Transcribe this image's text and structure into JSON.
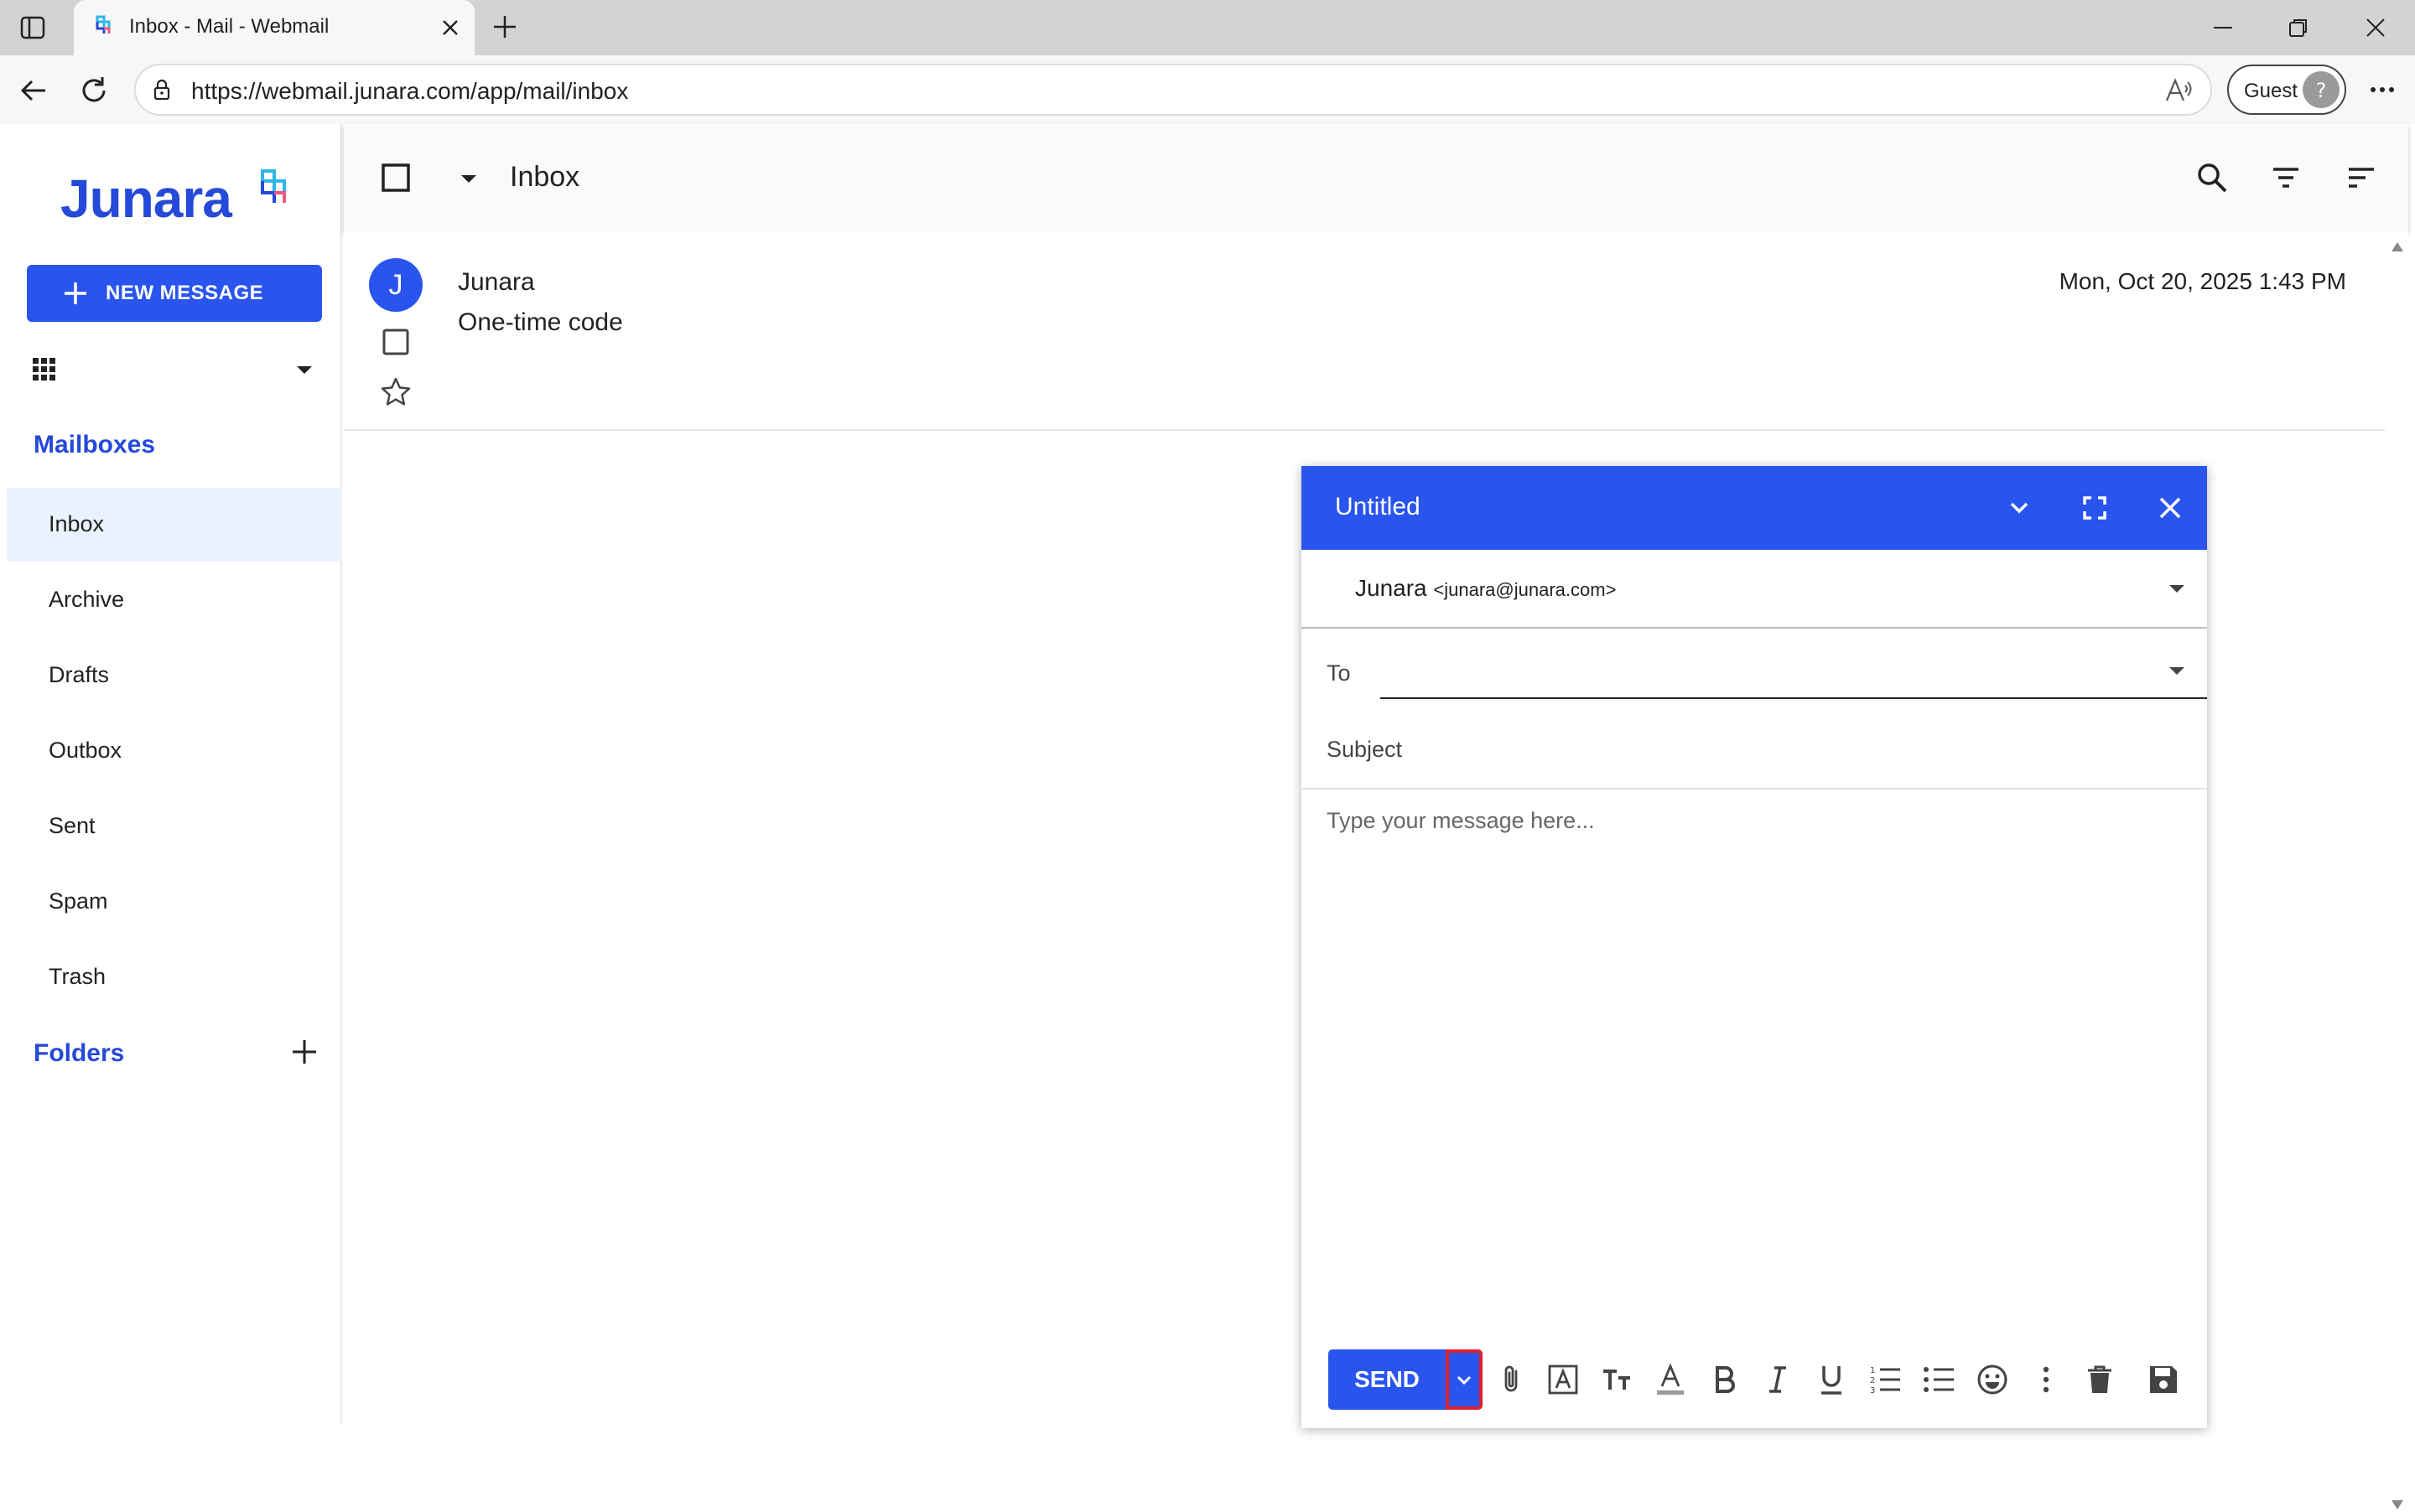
{
  "browser": {
    "tab_title": "Inbox - Mail - Webmail",
    "url": "https://webmail.junara.com/app/mail/inbox",
    "profile_label": "Guest"
  },
  "sidebar": {
    "logo_text": "Junara",
    "new_message_label": "NEW MESSAGE",
    "mailboxes_heading": "Mailboxes",
    "items": [
      {
        "label": "Inbox",
        "active": true
      },
      {
        "label": "Archive"
      },
      {
        "label": "Drafts"
      },
      {
        "label": "Outbox"
      },
      {
        "label": "Sent"
      },
      {
        "label": "Spam"
      },
      {
        "label": "Trash"
      }
    ],
    "folders_heading": "Folders"
  },
  "toolbar": {
    "mailbox_title": "Inbox"
  },
  "messages": [
    {
      "avatar_letter": "J",
      "from": "Junara",
      "subject": "One-time code",
      "date": "Mon, Oct 20, 2025 1:43 PM"
    }
  ],
  "compose": {
    "title": "Untitled",
    "from_name": "Junara",
    "from_email": "<junara@junara.com>",
    "to_label": "To",
    "to_value": "",
    "subject_placeholder": "Subject",
    "body_placeholder": "Type your message here...",
    "send_label": "SEND"
  },
  "colors": {
    "accent": "#2a54ee",
    "brand_text": "#2549d8",
    "active_nav_bg": "#eaf3fd",
    "highlight_outline": "#e0212b"
  }
}
